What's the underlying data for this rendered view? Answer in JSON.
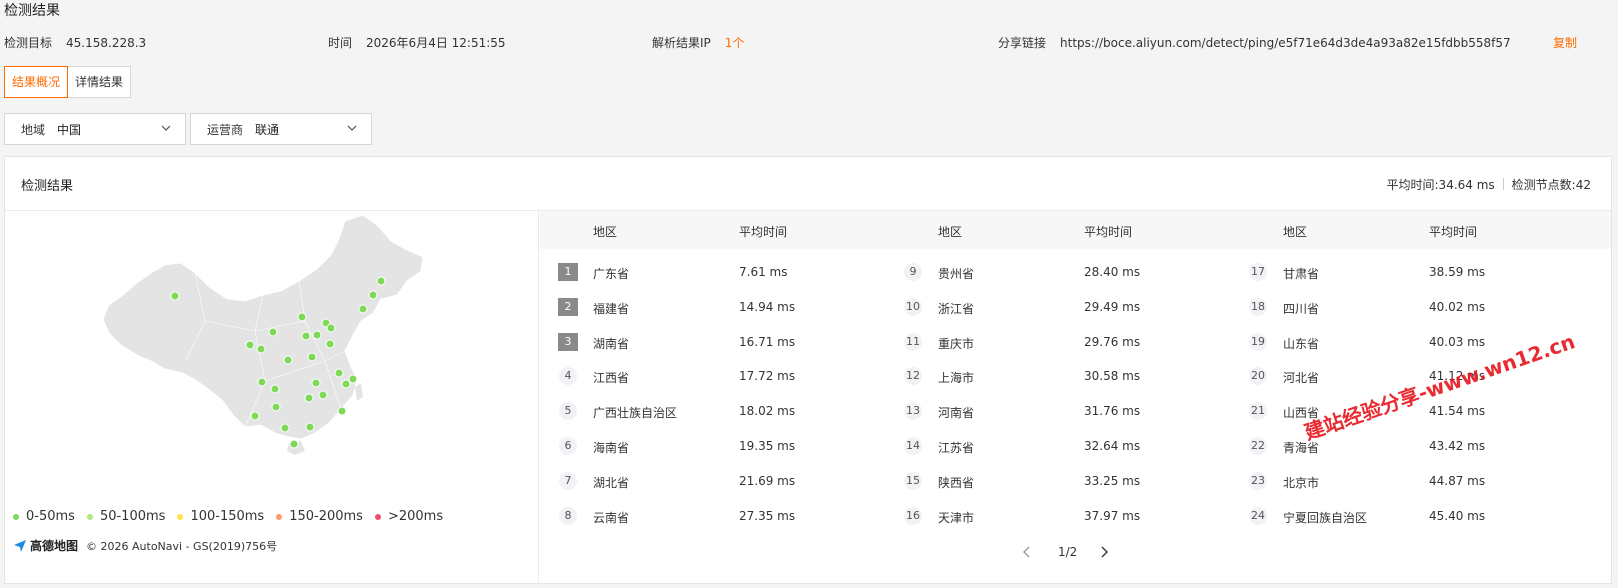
{
  "page": {
    "title": "检测结果"
  },
  "meta": {
    "target_label": "检测目标",
    "target_value": "45.158.228.3",
    "time_label": "时间",
    "time_value": "2026年6月4日 12:51:55",
    "ip_label": "解析结果IP",
    "ip_value": "1个",
    "share_label": "分享链接",
    "share_value": "https://boce.aliyun.com/detect/ping/e5f71e64d3de4a93a82e15fdbb558f57",
    "copy_label": "复制"
  },
  "tabs": [
    {
      "label": "结果概况",
      "active": true
    },
    {
      "label": "详情结果",
      "active": false
    }
  ],
  "filters": {
    "region_label": "地域",
    "region_value": "中国",
    "isp_label": "运营商",
    "isp_value": "联通"
  },
  "panel": {
    "title": "检测结果",
    "avg_time": "平均时间:34.64 ms",
    "node_count": "检测节点数:42"
  },
  "legend": [
    {
      "label": "0-50ms",
      "color": "#7ed957"
    },
    {
      "label": "50-100ms",
      "color": "#b4e87a"
    },
    {
      "label": "100-150ms",
      "color": "#ffe34a"
    },
    {
      "label": "150-200ms",
      "color": "#ff9b6b"
    },
    {
      "label": ">200ms",
      "color": "#f0506e"
    }
  ],
  "attribution": {
    "logo": "高德地图",
    "copyright": "© 2026 AutoNavi - GS(2019)756号"
  },
  "table": {
    "col_region": "地区",
    "col_avg": "平均时间",
    "rows": [
      {
        "rank": "1",
        "region": "广东省",
        "avg": "7.61 ms"
      },
      {
        "rank": "2",
        "region": "福建省",
        "avg": "14.94 ms"
      },
      {
        "rank": "3",
        "region": "湖南省",
        "avg": "16.71 ms"
      },
      {
        "rank": "4",
        "region": "江西省",
        "avg": "17.72 ms"
      },
      {
        "rank": "5",
        "region": "广西壮族自治区",
        "avg": "18.02 ms"
      },
      {
        "rank": "6",
        "region": "海南省",
        "avg": "19.35 ms"
      },
      {
        "rank": "7",
        "region": "湖北省",
        "avg": "21.69 ms"
      },
      {
        "rank": "8",
        "region": "云南省",
        "avg": "27.35 ms"
      },
      {
        "rank": "9",
        "region": "贵州省",
        "avg": "28.40 ms"
      },
      {
        "rank": "10",
        "region": "浙江省",
        "avg": "29.49 ms"
      },
      {
        "rank": "11",
        "region": "重庆市",
        "avg": "29.76 ms"
      },
      {
        "rank": "12",
        "region": "上海市",
        "avg": "30.58 ms"
      },
      {
        "rank": "13",
        "region": "河南省",
        "avg": "31.76 ms"
      },
      {
        "rank": "14",
        "region": "江苏省",
        "avg": "32.64 ms"
      },
      {
        "rank": "15",
        "region": "陕西省",
        "avg": "33.25 ms"
      },
      {
        "rank": "16",
        "region": "天津市",
        "avg": "37.97 ms"
      },
      {
        "rank": "17",
        "region": "甘肃省",
        "avg": "38.59 ms"
      },
      {
        "rank": "18",
        "region": "四川省",
        "avg": "40.02 ms"
      },
      {
        "rank": "19",
        "region": "山东省",
        "avg": "40.03 ms"
      },
      {
        "rank": "20",
        "region": "河北省",
        "avg": "41.12 ms"
      },
      {
        "rank": "21",
        "region": "山西省",
        "avg": "41.54 ms"
      },
      {
        "rank": "22",
        "region": "青海省",
        "avg": "43.42 ms"
      },
      {
        "rank": "23",
        "region": "北京市",
        "avg": "44.87 ms"
      },
      {
        "rank": "24",
        "region": "宁夏回族自治区",
        "avg": "45.40 ms"
      }
    ]
  },
  "pager": {
    "text": "1/2"
  },
  "watermark": "建站经验分享-www.wn12.cn",
  "icons": {
    "dropdown": "chevron-down-icon",
    "prev": "chevron-left-icon",
    "next": "chevron-right-icon",
    "map_logo": "amap-logo-icon"
  }
}
